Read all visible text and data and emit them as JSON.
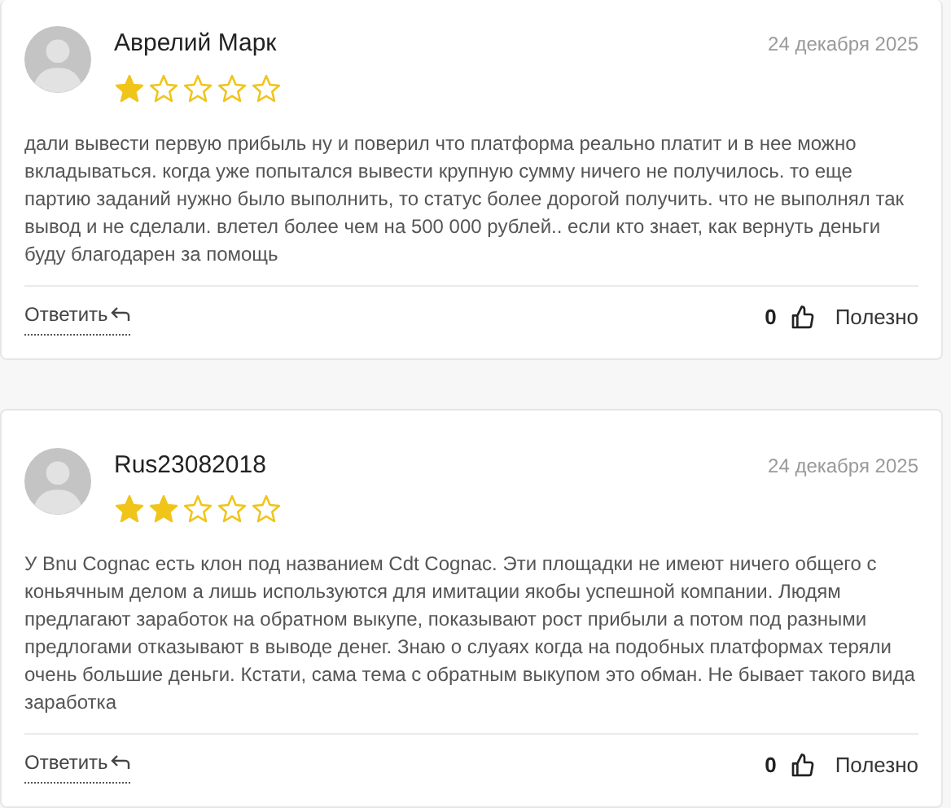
{
  "reviews": [
    {
      "author": "Аврелий Марк",
      "date": "24 декабря 2025",
      "stars": 1,
      "text": "дали вывести первую прибыль ну и поверил что платформа реально платит и в нее можно вкладываться. когда уже попытался вывести крупную сумму ничего не получилось. то еще партию заданий нужно было выполнить, то статус более дорогой получить. что не выполнял так вывод и не сделали. влетел более чем на 500 000 рублей.. если кто знает, как вернуть деньги буду благодарен за помощь",
      "reply": "Ответить",
      "likes": "0",
      "helpful": "Полезно"
    },
    {
      "author": "Rus23082018",
      "date": "24 декабря 2025",
      "stars": 2,
      "text": "У Bnu Cognac есть клон под названием Cdt Cognac. Эти площадки не имеют ничего общего с коньячным делом а лишь используются для имитации якобы успешной компании. Людям предлагают заработок на обратном выкупе, показывают рост прибыли а потом под разными предлогами отказывают в выводе денег. Знаю о слуаях когда на подобных платформах теряли очень большие деньги. Кстати, сама тема с обратным выкупом это обман. Не бывает такого вида заработка",
      "reply": "Ответить",
      "likes": "0",
      "helpful": "Полезно"
    }
  ]
}
